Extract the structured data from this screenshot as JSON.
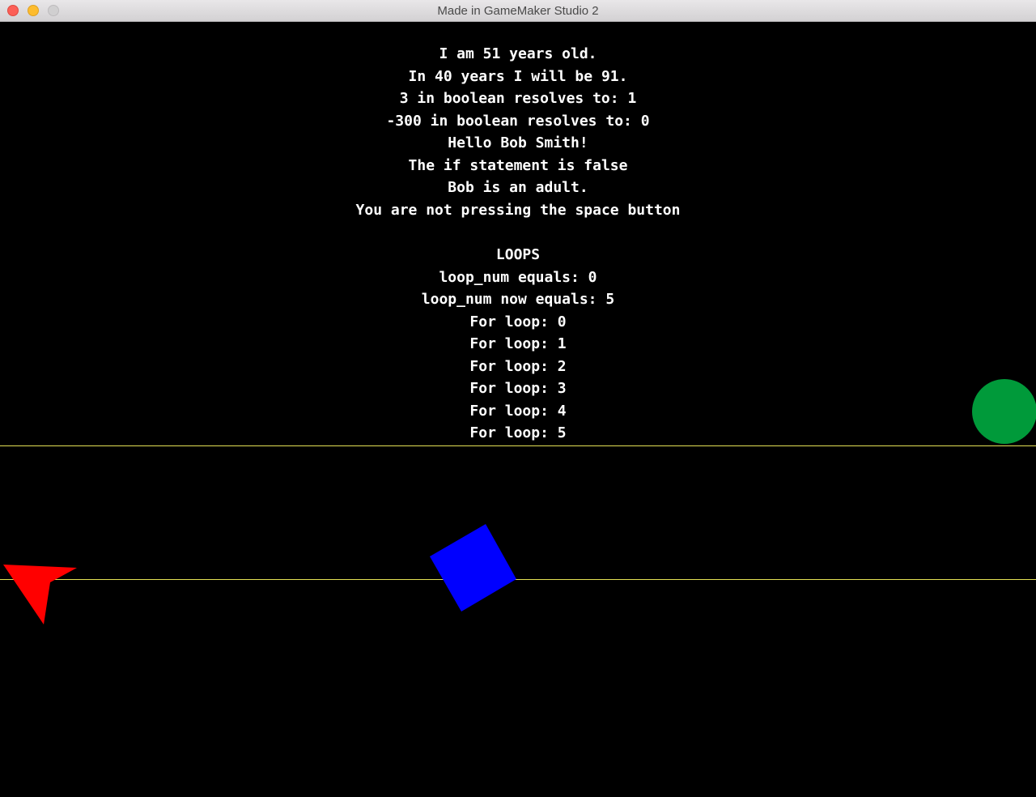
{
  "window": {
    "title": "Made in GameMaker Studio 2"
  },
  "game": {
    "lines": [
      "I am 51 years old.",
      "In 40 years I will be 91.",
      "3 in boolean resolves to: 1",
      "-300 in boolean resolves to: 0",
      "Hello Bob Smith!",
      "The if statement is false",
      "Bob is an adult.",
      "You are not pressing the space button"
    ],
    "loops_heading": "LOOPS",
    "loop_lines": [
      "loop_num equals: 0",
      "loop_num now equals: 5",
      "For loop: 0",
      "For loop: 1",
      "For loop: 2",
      "For loop: 3",
      "For loop: 4",
      "For loop: 5"
    ],
    "colors": {
      "background": "#000000",
      "text": "#ffffff",
      "line": "#e4e055",
      "circle": "#009a3a",
      "square": "#0000ff",
      "arrow": "#ff0000"
    }
  }
}
